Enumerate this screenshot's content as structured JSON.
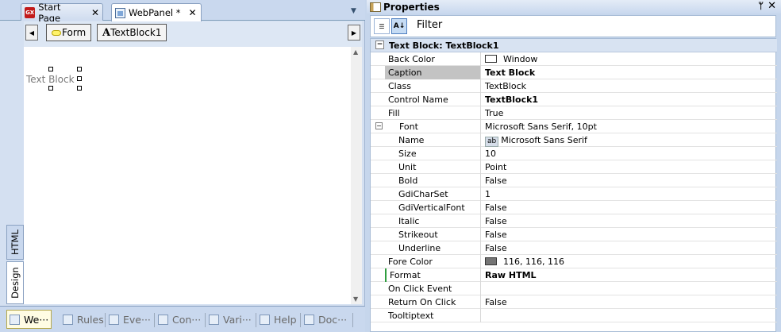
{
  "left_pane": {
    "tabs": [
      {
        "label": "Start Page",
        "close": "✕",
        "logo": "GX"
      },
      {
        "label": "WebPanel *",
        "close": "✕"
      }
    ],
    "tab_menu": "▼",
    "breadcrumbs": [
      "Form",
      "TextBlock1"
    ],
    "nav_left": "◀",
    "nav_right": "▶",
    "canvas_textblock": "Text Block",
    "side_tabs": [
      "HTML",
      "Design"
    ],
    "bottom_tabs": [
      {
        "label": "We···",
        "icon": "webpanel-icon"
      },
      {
        "label": "Rules",
        "icon": "rules-icon"
      },
      {
        "label": "Eve···",
        "icon": "events-icon"
      },
      {
        "label": "Con···",
        "icon": "conditions-icon"
      },
      {
        "label": "Vari···",
        "icon": "variables-icon"
      },
      {
        "label": "Help",
        "icon": "help-icon"
      },
      {
        "label": "Doc···",
        "icon": "documentation-icon"
      }
    ]
  },
  "properties": {
    "title": "Properties",
    "pin": "ᛘ",
    "close": "✕",
    "filter_label": "Filter",
    "section": "Text Block: TextBlock1",
    "rows": [
      {
        "name": "Back Color",
        "value": "Window",
        "swatch": "#ffffff"
      },
      {
        "name": "Caption",
        "value": "Text Block",
        "bold": true,
        "selected": true
      },
      {
        "name": "Class",
        "value": "TextBlock"
      },
      {
        "name": "Control Name",
        "value": "TextBlock1",
        "bold": true
      },
      {
        "name": "Fill",
        "value": "True"
      },
      {
        "name": "Font",
        "value": "Microsoft Sans Serif, 10pt",
        "expander": "−"
      },
      {
        "name": "Name",
        "value": "Microsoft Sans Serif",
        "sub": true,
        "icon": "ab"
      },
      {
        "name": "Size",
        "value": "10",
        "sub": true
      },
      {
        "name": "Unit",
        "value": "Point",
        "sub": true
      },
      {
        "name": "Bold",
        "value": "False",
        "sub": true
      },
      {
        "name": "GdiCharSet",
        "value": "1",
        "sub": true
      },
      {
        "name": "GdiVerticalFont",
        "value": "False",
        "sub": true
      },
      {
        "name": "Italic",
        "value": "False",
        "sub": true
      },
      {
        "name": "Strikeout",
        "value": "False",
        "sub": true
      },
      {
        "name": "Underline",
        "value": "False",
        "sub": true
      },
      {
        "name": "Fore Color",
        "value": "116, 116, 116",
        "swatch": "#747474"
      },
      {
        "name": "Format",
        "value": "Raw HTML",
        "bold": true,
        "marker": true
      },
      {
        "name": "On Click Event",
        "value": ""
      },
      {
        "name": "Return On Click",
        "value": "False"
      },
      {
        "name": "Tooltiptext",
        "value": ""
      }
    ]
  }
}
